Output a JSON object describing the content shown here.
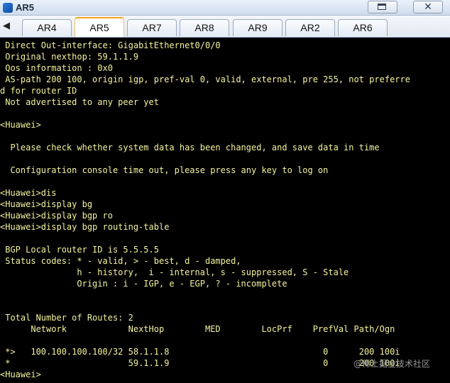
{
  "window": {
    "title": "AR5"
  },
  "tabs": [
    {
      "label": "AR4",
      "active": false
    },
    {
      "label": "AR5",
      "active": true
    },
    {
      "label": "AR7",
      "active": false
    },
    {
      "label": "AR8",
      "active": false
    },
    {
      "label": "AR9",
      "active": false
    },
    {
      "label": "AR2",
      "active": false
    },
    {
      "label": "AR6",
      "active": false
    }
  ],
  "terminal": {
    "text_color": "#f4f39a",
    "background": "#000000",
    "lines": [
      " Direct Out-interface: GigabitEthernet0/0/0",
      " Original nexthop: 59.1.1.9",
      " Qos information : 0x0",
      " AS-path 200 100, origin igp, pref-val 0, valid, external, pre 255, not preferre",
      "d for router ID",
      " Not advertised to any peer yet",
      "",
      "<Huawei>",
      "",
      "  Please check whether system data has been changed, and save data in time",
      "",
      "  Configuration console time out, please press any key to log on",
      "",
      "<Huawei>dis",
      "<Huawei>display bg",
      "<Huawei>display bgp ro",
      "<Huawei>display bgp routing-table",
      "",
      " BGP Local router ID is 5.5.5.5",
      " Status codes: * - valid, > - best, d - damped,",
      "               h - history,  i - internal, s - suppressed, S - Stale",
      "               Origin : i - IGP, e - EGP, ? - incomplete",
      "",
      "",
      " Total Number of Routes: 2",
      "      Network            NextHop        MED        LocPrf    PrefVal Path/Ogn",
      "",
      " *>   100.100.100.100/32 58.1.1.8                              0      200 100i",
      " *                       59.1.1.9                              0      200 100i",
      "<Huawei>"
    ]
  },
  "watermark": {
    "text": "@稀土掘金技术社区"
  }
}
